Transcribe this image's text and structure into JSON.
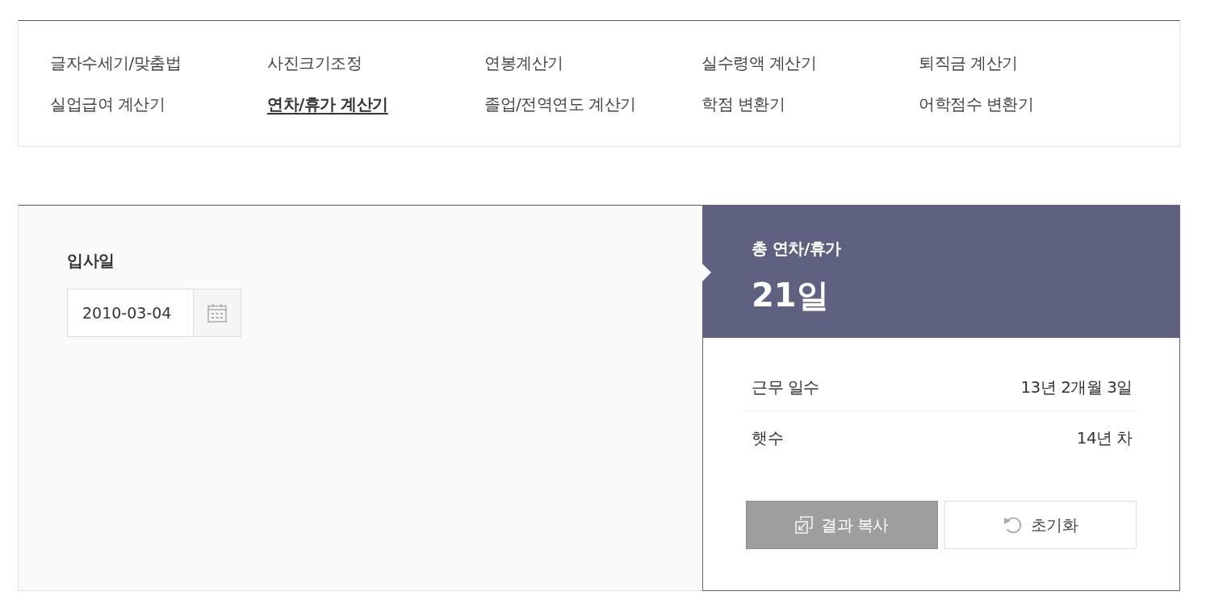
{
  "nav": {
    "items": [
      {
        "label": "글자수세기/맞춤법",
        "selected": false
      },
      {
        "label": "사진크기조정",
        "selected": false
      },
      {
        "label": "연봉계산기",
        "selected": false
      },
      {
        "label": "실수령액 계산기",
        "selected": false
      },
      {
        "label": "퇴직금 계산기",
        "selected": false
      },
      {
        "label": "실업급여 계산기",
        "selected": false
      },
      {
        "label": "연차/휴가 계산기",
        "selected": true
      },
      {
        "label": "졸업/전역연도 계산기",
        "selected": false
      },
      {
        "label": "학점 변환기",
        "selected": false
      },
      {
        "label": "어학점수 변환기",
        "selected": false
      }
    ]
  },
  "calculator": {
    "field": {
      "label": "입사일",
      "value": "2010-03-04"
    },
    "result": {
      "title": "총 연차/휴가",
      "total": "21일",
      "rows": [
        {
          "label": "근무 일수",
          "value": "13년 2개월 3일"
        },
        {
          "label": "햇수",
          "value": "14년 차"
        }
      ],
      "buttons": [
        {
          "label": "결과 복사",
          "kind": "primary"
        },
        {
          "label": "초기화",
          "kind": "secondary"
        }
      ]
    }
  }
}
